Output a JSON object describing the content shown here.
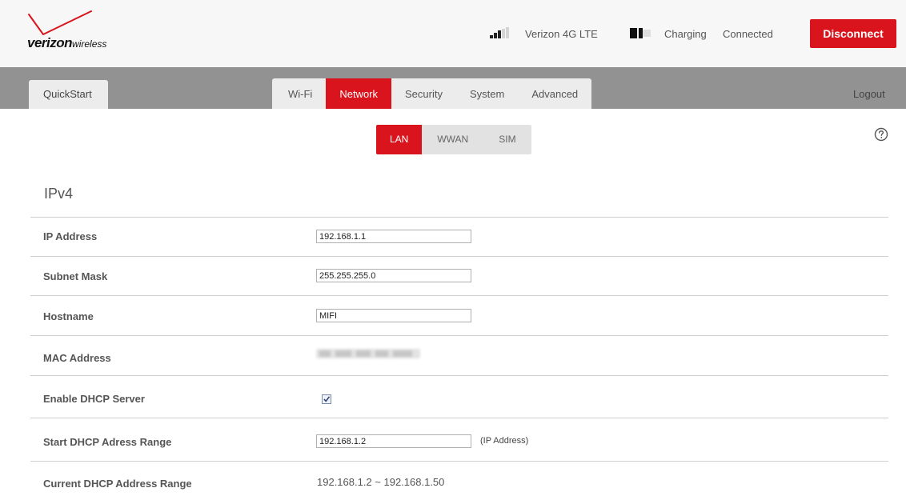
{
  "header": {
    "brand": "verizon",
    "brand_suffix": "wireless",
    "network": "Verizon 4G LTE",
    "battery_status": "Charging",
    "connection_status": "Connected",
    "disconnect_label": "Disconnect",
    "signal_bars_lit": 3,
    "signal_bars_total": 5,
    "icons": {
      "signal": "signal-strength-icon",
      "battery": "battery-icon",
      "logo": "verizon-check-logo"
    }
  },
  "nav": {
    "quickstart_label": "QuickStart",
    "tabs": [
      {
        "label": "Wi-Fi",
        "active": false
      },
      {
        "label": "Network",
        "active": true
      },
      {
        "label": "Security",
        "active": false
      },
      {
        "label": "System",
        "active": false
      },
      {
        "label": "Advanced",
        "active": false
      }
    ],
    "logout_label": "Logout"
  },
  "subtabs": [
    {
      "label": "LAN",
      "active": true
    },
    {
      "label": "WWAN",
      "active": false
    },
    {
      "label": "SIM",
      "active": false
    }
  ],
  "help_icon": "help-circle-icon",
  "section": {
    "title": "IPv4"
  },
  "fields": {
    "ip_address": {
      "label": "IP Address",
      "value": "192.168.1.1"
    },
    "subnet_mask": {
      "label": "Subnet Mask",
      "value": "255.255.255.0"
    },
    "hostname": {
      "label": "Hostname",
      "value": "MIFI"
    },
    "mac_address": {
      "label": "MAC Address"
    },
    "dhcp_enable": {
      "label": "Enable DHCP Server",
      "checked": true
    },
    "dhcp_start": {
      "label": "Start DHCP Adress Range",
      "value": "192.168.1.2",
      "hint": "(IP Address)"
    },
    "dhcp_current": {
      "label": "Current DHCP Address Range",
      "value": "192.168.1.2 ~ 192.168.1.50"
    }
  },
  "colors": {
    "brand_red": "#d9141c",
    "nav_band": "#929292",
    "header_bg": "#f7f7f7",
    "divider": "#cfcfcf"
  }
}
